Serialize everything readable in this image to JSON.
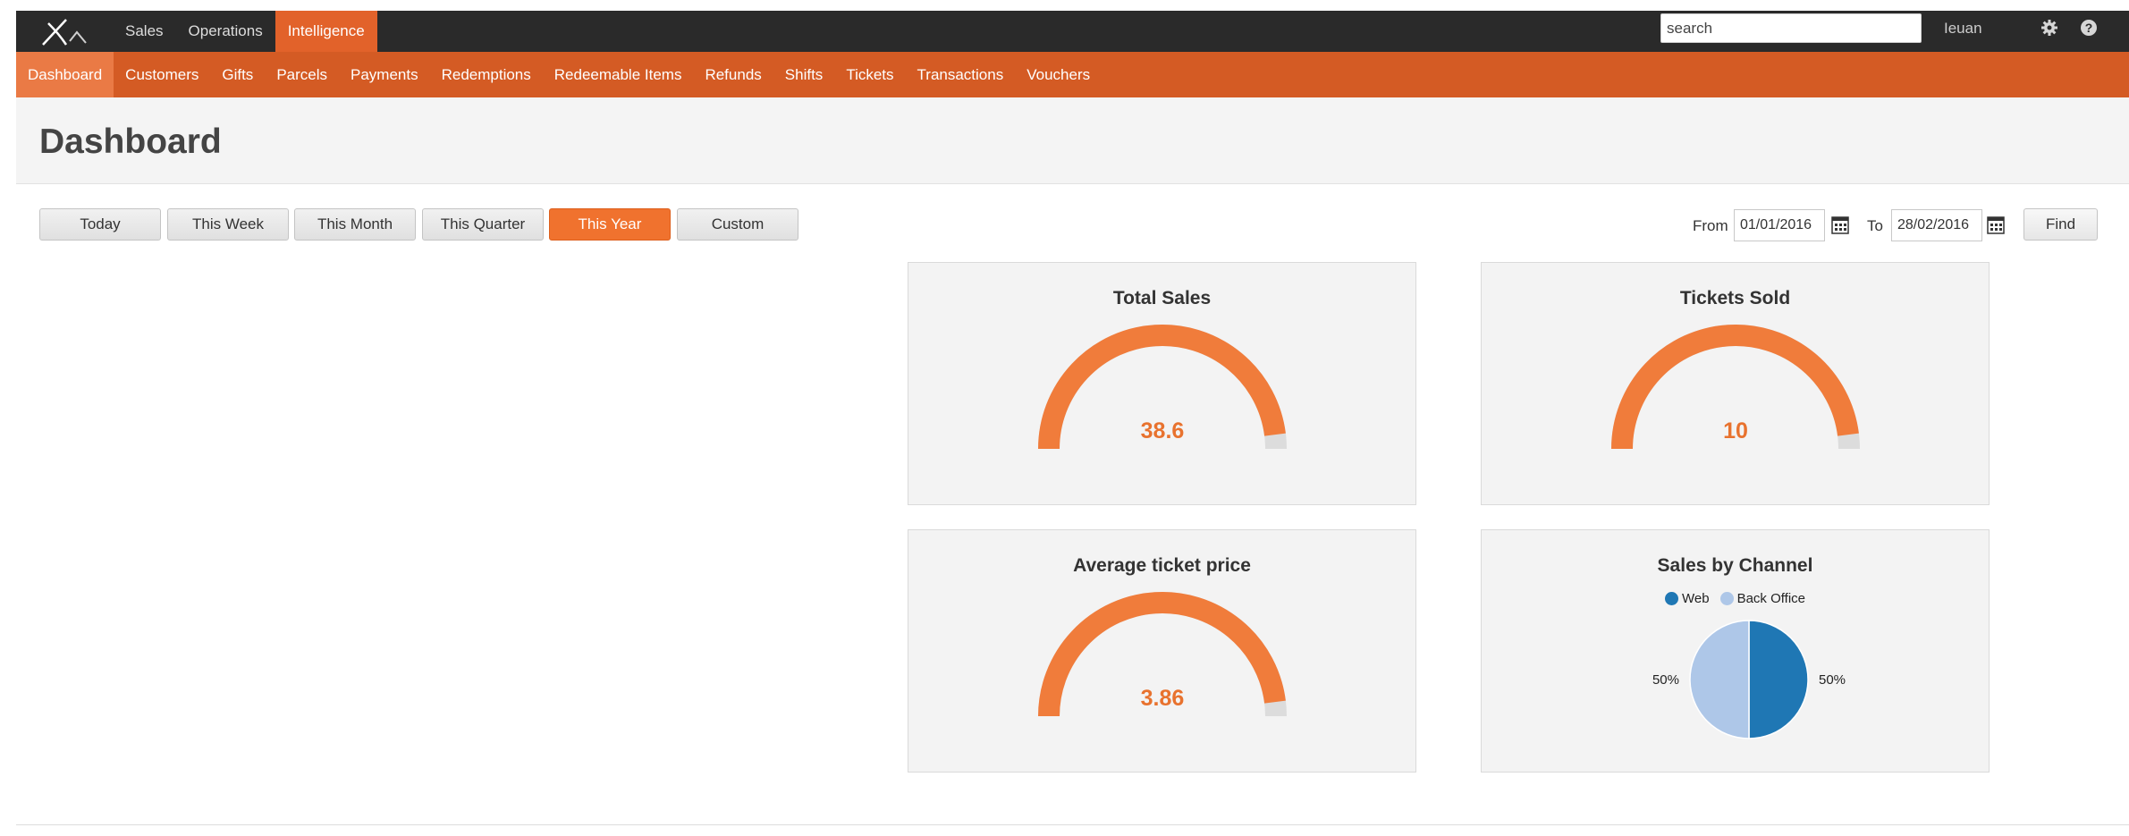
{
  "topnav": {
    "items": [
      "Sales",
      "Operations",
      "Intelligence"
    ],
    "active": 2,
    "search_placeholder": "search",
    "user": "Ieuan"
  },
  "subnav": {
    "items": [
      "Dashboard",
      "Customers",
      "Gifts",
      "Parcels",
      "Payments",
      "Redemptions",
      "Redeemable Items",
      "Refunds",
      "Shifts",
      "Tickets",
      "Transactions",
      "Vouchers"
    ],
    "active": 0
  },
  "page": {
    "title": "Dashboard"
  },
  "range": {
    "buttons": [
      "Today",
      "This Week",
      "This Month",
      "This Quarter",
      "This Year",
      "Custom"
    ],
    "active": 4
  },
  "filter": {
    "from_label": "From",
    "from_value": "01/01/2016",
    "to_label": "To",
    "to_value": "28/02/2016",
    "find_label": "Find"
  },
  "colors": {
    "accent": "#e8722e",
    "nav_bg": "#2a2a2a",
    "subnav_bg": "#d45b24",
    "web": "#1f77b4",
    "back_office": "#aec7e8"
  },
  "gauges": [
    {
      "title": "Total Sales",
      "value": "38.6",
      "fill": 0.96
    },
    {
      "title": "Tickets Sold",
      "value": "10",
      "fill": 0.96
    },
    {
      "title": "Average ticket price",
      "value": "3.86",
      "fill": 0.96
    }
  ],
  "channel": {
    "title": "Sales by Channel",
    "legend": [
      "Web",
      "Back Office"
    ],
    "chart_data": {
      "type": "pie",
      "categories": [
        "Web",
        "Back Office"
      ],
      "values": [
        50,
        50
      ],
      "labels": [
        "50%",
        "50%"
      ],
      "legend_position": "top"
    }
  }
}
